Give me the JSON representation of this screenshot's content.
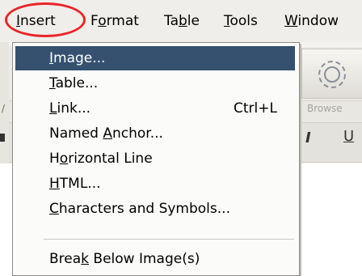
{
  "menubar": {
    "items": [
      {
        "label": "Insert"
      },
      {
        "label": "Format"
      },
      {
        "label": "Table"
      },
      {
        "label": "Tools"
      },
      {
        "label": "Window"
      }
    ]
  },
  "toolbar": {
    "browse_label": "Browse",
    "italic_label": "I",
    "underline_label": "U"
  },
  "menu": {
    "items": [
      {
        "label": "Image...",
        "shortcut": "",
        "active": true
      },
      {
        "label": "Table...",
        "shortcut": ""
      },
      {
        "label": "Link...",
        "shortcut": "Ctrl+L"
      },
      {
        "label": "Named Anchor...",
        "shortcut": ""
      },
      {
        "label": "Horizontal Line",
        "shortcut": ""
      },
      {
        "label": "HTML...",
        "shortcut": ""
      },
      {
        "label": "Characters and Symbols...",
        "shortcut": ""
      },
      {
        "label": "Break Below Image(s)",
        "shortcut": ""
      }
    ]
  },
  "colors": {
    "highlight_ring": "#e8262b",
    "active_item_bg": "#35516f"
  }
}
